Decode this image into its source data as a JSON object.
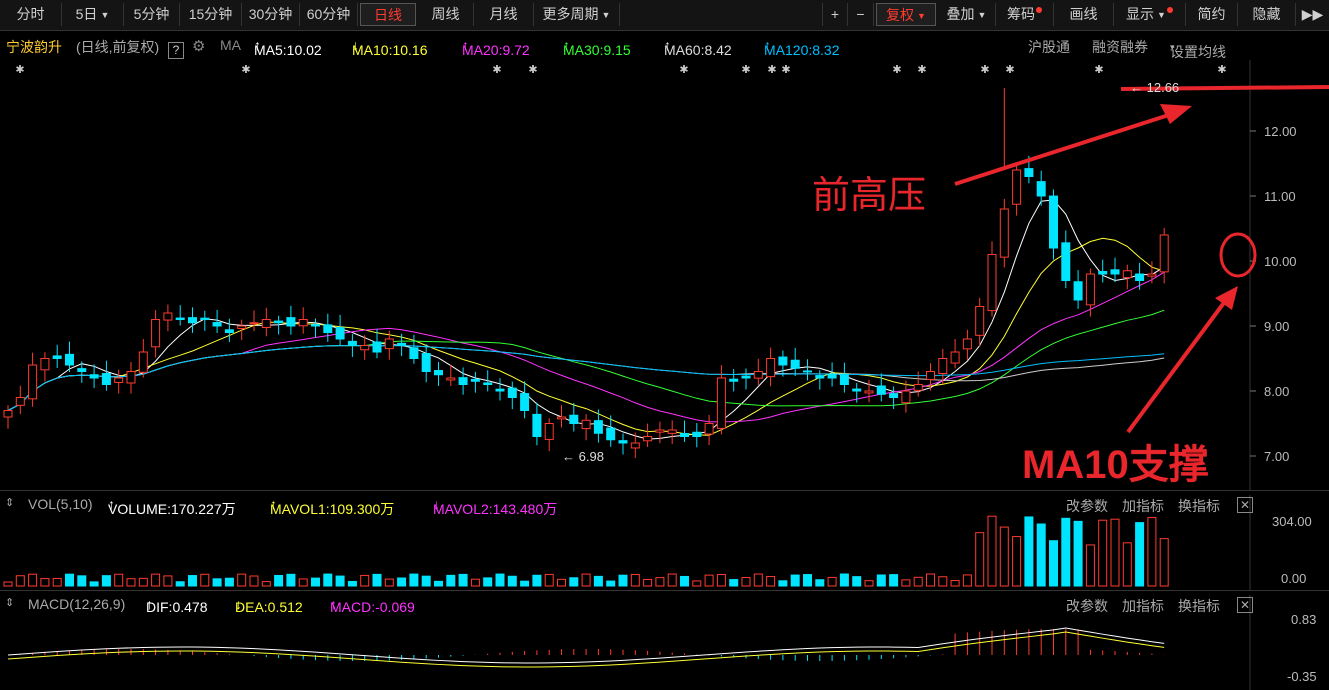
{
  "toolbar": {
    "left_tabs": [
      "分时",
      "5日",
      "5分钟",
      "15分钟",
      "30分钟",
      "60分钟",
      "日线",
      "周线",
      "月线",
      "更多周期"
    ],
    "active_tab": "日线",
    "right_buttons": [
      "+",
      "−",
      "复权",
      "叠加",
      "筹码",
      "画线",
      "显示",
      "简约",
      "隐藏",
      "▶▶"
    ]
  },
  "info": {
    "stock_name": "宁波韵升",
    "mode": "(日线,前复权)",
    "help": "?",
    "ma_label": "MA",
    "ma5": "MA5:10.02",
    "ma10": "MA10:10.16",
    "ma20": "MA20:9.72",
    "ma30": "MA30:9.15",
    "ma60": "MA60:8.42",
    "ma120": "MA120:8.32",
    "links": [
      "沪股通",
      "融资融券",
      "设置均线"
    ]
  },
  "colors": {
    "up": "#ff3b30",
    "down": "#00e5ff",
    "ma5": "#ffffff",
    "ma10": "#ffff33",
    "ma20": "#ff33ff",
    "ma30": "#33ff33",
    "ma60": "#cccccc",
    "ma120": "#00bfff",
    "annotation": "#e8262c"
  },
  "price_axis": [
    "12.00",
    "11.00",
    "10.00",
    "9.00",
    "8.00",
    "7.00"
  ],
  "price_high_label": "12.66",
  "price_low_label": "6.98",
  "annotations": {
    "resistance": "前高压",
    "support": "MA10支撑"
  },
  "volume_panel": {
    "title": "VOL(5,10)",
    "volume": "VOLUME:170.227万",
    "mavol1": "MAVOL1:109.300万",
    "mavol2": "MAVOL2:143.480万",
    "buttons": [
      "改参数",
      "加指标",
      "换指标"
    ],
    "axis": [
      "304.00",
      "0.00"
    ]
  },
  "macd_panel": {
    "title": "MACD(12,26,9)",
    "dif": "DIF:0.478",
    "dea": "DEA:0.512",
    "macd": "MACD:-0.069",
    "buttons": [
      "改参数",
      "加指标",
      "换指标"
    ],
    "axis": [
      "0.83",
      "-0.35"
    ]
  }
}
